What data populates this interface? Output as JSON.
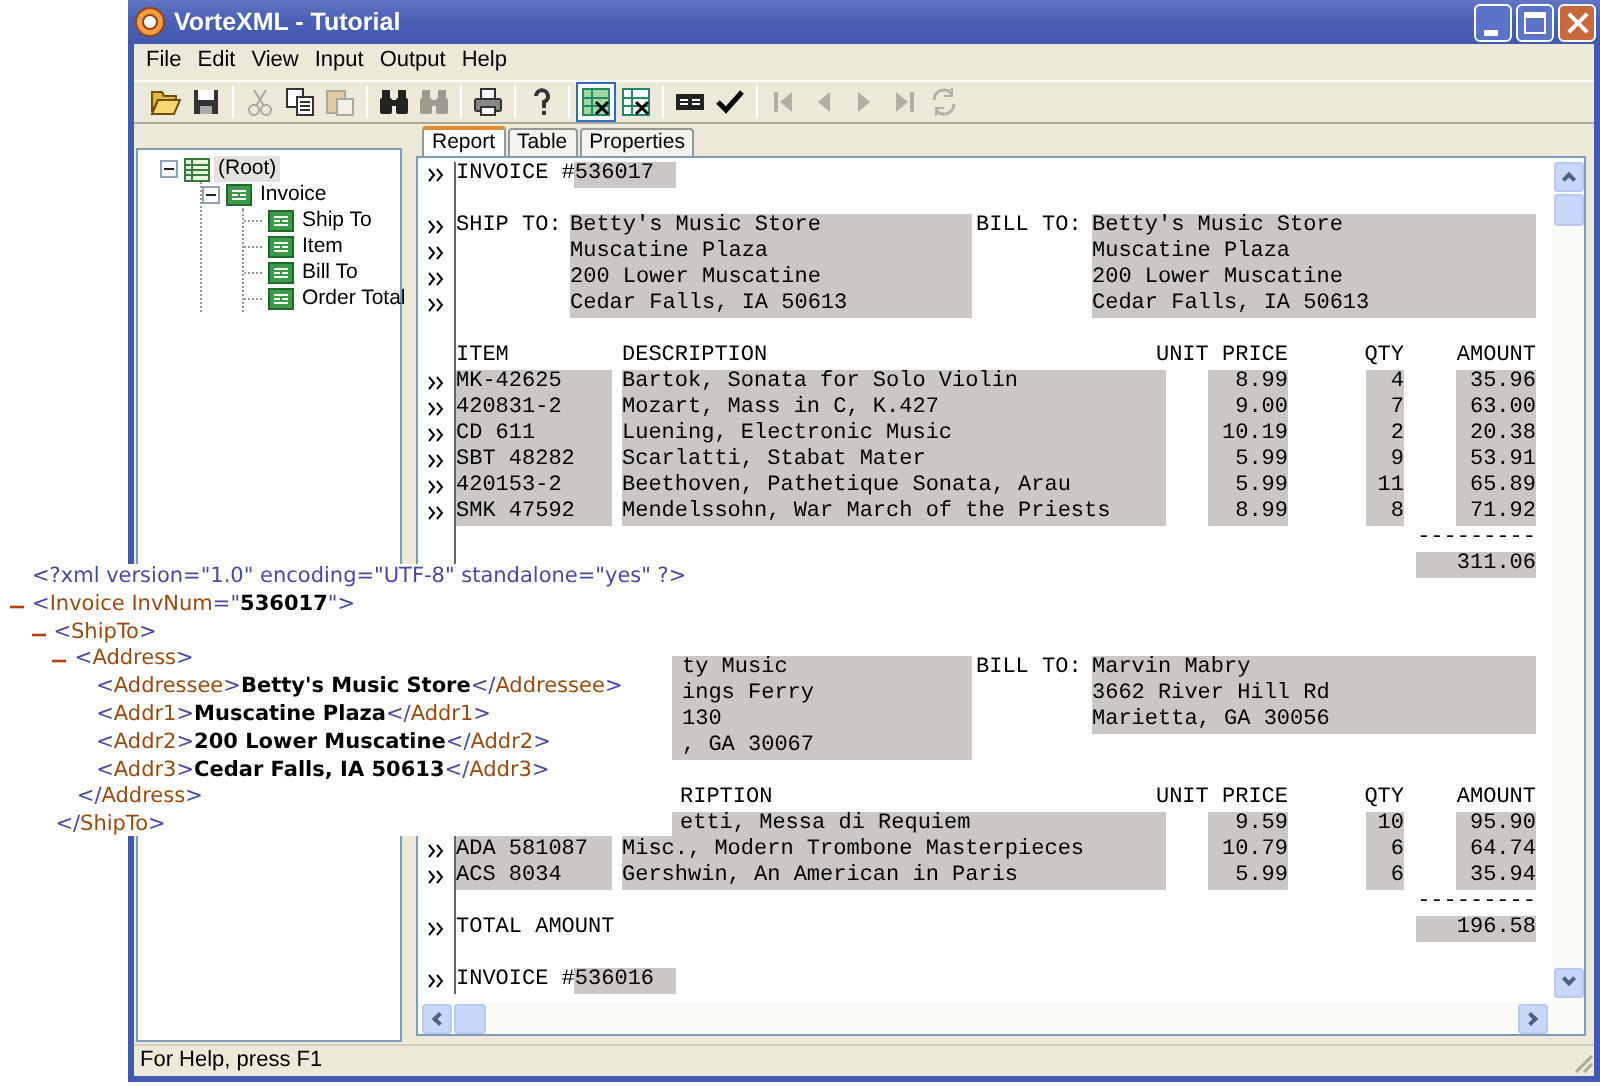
{
  "window": {
    "title": "VorteXML - Tutorial"
  },
  "menu": [
    "File",
    "Edit",
    "View",
    "Input",
    "Output",
    "Help"
  ],
  "toolbar": [
    {
      "kind": "open",
      "disabled": false
    },
    {
      "kind": "save",
      "disabled": false
    },
    {
      "kind": "separator"
    },
    {
      "kind": "cut",
      "disabled": true
    },
    {
      "kind": "copy",
      "disabled": false
    },
    {
      "kind": "paste",
      "disabled": true
    },
    {
      "kind": "separator"
    },
    {
      "kind": "find",
      "disabled": false
    },
    {
      "kind": "find_next",
      "disabled": true
    },
    {
      "kind": "separator"
    },
    {
      "kind": "print",
      "disabled": false
    },
    {
      "kind": "separator"
    },
    {
      "kind": "help",
      "disabled": false
    },
    {
      "kind": "separator"
    },
    {
      "kind": "tree_view",
      "disabled": false,
      "selected": true
    },
    {
      "kind": "xml_view",
      "disabled": false,
      "selected": false
    },
    {
      "kind": "separator"
    },
    {
      "kind": "form",
      "disabled": false
    },
    {
      "kind": "check",
      "disabled": false
    },
    {
      "kind": "separator"
    },
    {
      "kind": "first",
      "disabled": true
    },
    {
      "kind": "prev",
      "disabled": true
    },
    {
      "kind": "next",
      "disabled": true
    },
    {
      "kind": "last",
      "disabled": true
    },
    {
      "kind": "refresh",
      "disabled": true
    }
  ],
  "tree": {
    "label": "(Root)",
    "selected": true,
    "expanded": true,
    "children": [
      {
        "label": "Invoice",
        "selected": false,
        "expanded": true,
        "children": [
          {
            "label": "Ship To",
            "selected": false
          },
          {
            "label": "Item",
            "selected": false
          },
          {
            "label": "Bill To",
            "selected": false
          },
          {
            "label": "Order Total",
            "selected": false
          }
        ]
      }
    ]
  },
  "tabs": [
    {
      "label": "Report",
      "selected": true
    },
    {
      "label": "Table",
      "selected": false
    },
    {
      "label": "Properties",
      "selected": false
    }
  ],
  "report": {
    "invoices": [
      {
        "kind": "full",
        "number_label": "INVOICE #",
        "number": "536017",
        "ship_to_label": "SHIP TO:",
        "ship_to": [
          "Betty's Music Store",
          "Muscatine Plaza",
          "200 Lower Muscatine",
          "Cedar Falls, IA 50613"
        ],
        "bill_to_label": "BILL TO:",
        "bill_to": [
          "Betty's Music Store",
          "Muscatine Plaza",
          "200 Lower Muscatine",
          "Cedar Falls, IA 50613"
        ],
        "columns": {
          "item": "ITEM",
          "description": "DESCRIPTION",
          "unit_price": "UNIT PRICE",
          "qty": "QTY",
          "amount": "AMOUNT"
        },
        "items": [
          {
            "covered": false,
            "item": "MK-42625",
            "description": "Bartok, Sonata for Solo Violin",
            "unit_price": "8.99",
            "qty": "4",
            "amount": "35.96"
          },
          {
            "covered": false,
            "item": "420831-2",
            "description": "Mozart, Mass in C, K.427",
            "unit_price": "9.00",
            "qty": "7",
            "amount": "63.00"
          },
          {
            "covered": false,
            "item": "CD 611",
            "description": "Luening, Electronic Music",
            "unit_price": "10.19",
            "qty": "2",
            "amount": "20.38"
          },
          {
            "covered": false,
            "item": "SBT 48282",
            "description": "Scarlatti, Stabat Mater",
            "unit_price": "5.99",
            "qty": "9",
            "amount": "53.91"
          },
          {
            "covered": false,
            "item": "420153-2",
            "description": "Beethoven, Pathetique Sonata, Arau",
            "unit_price": "5.99",
            "qty": "11",
            "amount": "65.89"
          },
          {
            "covered": false,
            "item": "SMK 47592",
            "description": "Mendelssohn, War March of the Priests",
            "unit_price": "8.99",
            "qty": "8",
            "amount": "71.92"
          }
        ],
        "rule": "---------",
        "total": "311.06"
      },
      {
        "kind": "covered",
        "ship_to": [
          "ty Music",
          "ings Ferry",
          "130",
          ", GA 30067"
        ],
        "bill_to_label": "BILL TO:",
        "bill_to": [
          "Marvin Mabry",
          "3662 River Hill Rd",
          "Marietta, GA 30056"
        ],
        "columns": {
          "description": "RIPTION",
          "unit_price": "UNIT PRICE",
          "qty": "QTY",
          "amount": "AMOUNT"
        },
        "items": [
          {
            "covered": true,
            "description": "etti, Messa di Requiem",
            "unit_price": "9.59",
            "qty": "10",
            "amount": "95.90"
          },
          {
            "covered": false,
            "item": "ADA 581087",
            "description": "Misc., Modern Trombone Masterpieces",
            "unit_price": "10.79",
            "qty": "6",
            "amount": "64.74"
          },
          {
            "covered": false,
            "item": "ACS 8034",
            "description": "Gershwin, An American in Paris",
            "unit_price": "5.99",
            "qty": "6",
            "amount": "35.94"
          }
        ],
        "rule": "---------",
        "total_label": "TOTAL AMOUNT",
        "total": "196.58"
      },
      {
        "kind": "full",
        "number_label": "INVOICE #",
        "number": "536016"
      }
    ]
  },
  "xml_view": {
    "declaration": "<?xml version=\"1.0\" encoding=\"UTF-8\" standalone=\"yes\" ?>",
    "root": {
      "expanded": true,
      "line": [
        {
          "kind": "mark",
          "text": "<"
        },
        {
          "kind": "name",
          "text": "Invoice InvNum"
        },
        {
          "kind": "mark",
          "text": "=\""
        },
        {
          "kind": "value",
          "text": "536017"
        },
        {
          "kind": "mark",
          "text": "\">"
        }
      ],
      "children": [
        {
          "expanded": true,
          "line": [
            {
              "kind": "mark",
              "text": "<"
            },
            {
              "kind": "name",
              "text": "ShipTo"
            },
            {
              "kind": "mark",
              "text": ">"
            }
          ],
          "children": [
            {
              "expanded": true,
              "line": [
                {
                  "kind": "mark",
                  "text": "<"
                },
                {
                  "kind": "name",
                  "text": "Address"
                },
                {
                  "kind": "mark",
                  "text": ">"
                }
              ],
              "children": [
                {
                  "line": [
                    {
                      "kind": "mark",
                      "text": "<"
                    },
                    {
                      "kind": "name",
                      "text": "Addressee"
                    },
                    {
                      "kind": "mark",
                      "text": ">"
                    },
                    {
                      "kind": "value",
                      "text": "Betty's Music Store"
                    },
                    {
                      "kind": "mark",
                      "text": "</"
                    },
                    {
                      "kind": "name",
                      "text": "Addressee"
                    },
                    {
                      "kind": "mark",
                      "text": ">"
                    }
                  ]
                },
                {
                  "line": [
                    {
                      "kind": "mark",
                      "text": "<"
                    },
                    {
                      "kind": "name",
                      "text": "Addr1"
                    },
                    {
                      "kind": "mark",
                      "text": ">"
                    },
                    {
                      "kind": "value",
                      "text": "Muscatine Plaza"
                    },
                    {
                      "kind": "mark",
                      "text": "</"
                    },
                    {
                      "kind": "name",
                      "text": "Addr1"
                    },
                    {
                      "kind": "mark",
                      "text": ">"
                    }
                  ]
                },
                {
                  "line": [
                    {
                      "kind": "mark",
                      "text": "<"
                    },
                    {
                      "kind": "name",
                      "text": "Addr2"
                    },
                    {
                      "kind": "mark",
                      "text": ">"
                    },
                    {
                      "kind": "value",
                      "text": "200 Lower Muscatine"
                    },
                    {
                      "kind": "mark",
                      "text": "</"
                    },
                    {
                      "kind": "name",
                      "text": "Addr2"
                    },
                    {
                      "kind": "mark",
                      "text": ">"
                    }
                  ]
                },
                {
                  "line": [
                    {
                      "kind": "mark",
                      "text": "<"
                    },
                    {
                      "kind": "name",
                      "text": "Addr3"
                    },
                    {
                      "kind": "mark",
                      "text": ">"
                    },
                    {
                      "kind": "value",
                      "text": "Cedar Falls, IA 50613"
                    },
                    {
                      "kind": "mark",
                      "text": "</"
                    },
                    {
                      "kind": "name",
                      "text": "Addr3"
                    },
                    {
                      "kind": "mark",
                      "text": ">"
                    }
                  ]
                }
              ],
              "close_line": [
                {
                  "kind": "mark",
                  "text": "</"
                },
                {
                  "kind": "name",
                  "text": "Address"
                },
                {
                  "kind": "mark",
                  "text": ">"
                }
              ]
            }
          ],
          "close_line": [
            {
              "kind": "mark",
              "text": "</"
            },
            {
              "kind": "name",
              "text": "ShipTo"
            },
            {
              "kind": "mark",
              "text": ">"
            }
          ]
        }
      ]
    }
  },
  "status_bar": "For Help, press F1"
}
